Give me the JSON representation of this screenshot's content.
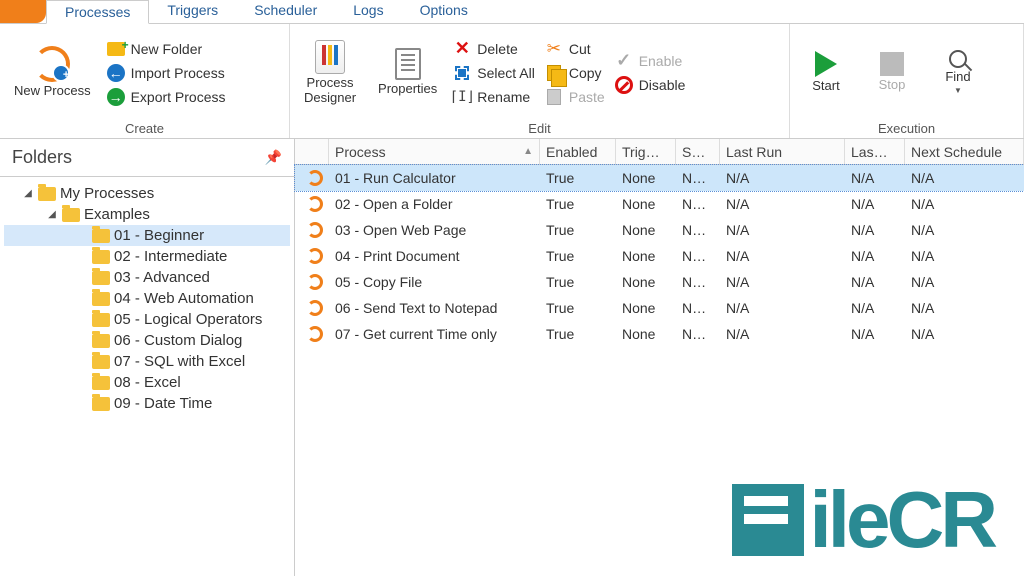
{
  "tabs": [
    "Processes",
    "Triggers",
    "Scheduler",
    "Logs",
    "Options"
  ],
  "ribbon": {
    "newProcess": "New Process",
    "newFolder": "New Folder",
    "importProcess": "Import Process",
    "exportProcess": "Export Process",
    "processDesigner": "Process\nDesigner",
    "properties": "Properties",
    "delete": "Delete",
    "selectAll": "Select All",
    "rename": "Rename",
    "cut": "Cut",
    "copy": "Copy",
    "paste": "Paste",
    "enable": "Enable",
    "disable": "Disable",
    "start": "Start",
    "stop": "Stop",
    "find": "Find",
    "groups": {
      "create": "Create",
      "edit": "Edit",
      "execution": "Execution"
    }
  },
  "foldersTitle": "Folders",
  "tree": {
    "root": "My Processes",
    "examples": "Examples",
    "items": [
      "01 - Beginner",
      "02 - Intermediate",
      "03 - Advanced",
      "04 - Web Automation",
      "05 - Logical Operators",
      "06 - Custom Dialog",
      "07 - SQL with Excel",
      "08 - Excel",
      "09 - Date Time"
    ],
    "selectedIndex": 0
  },
  "grid": {
    "headers": {
      "process": "Process",
      "enabled": "Enabled",
      "trigger": "Trig…",
      "s": "S…",
      "lastRun": "Last Run",
      "lasd": "Las…",
      "next": "Next Schedule"
    },
    "rows": [
      {
        "process": "01 - Run Calculator",
        "enabled": "True",
        "trigger": "None",
        "s": "N…",
        "lastRun": "N/A",
        "lasd": "N/A",
        "next": "N/A"
      },
      {
        "process": "02 - Open a Folder",
        "enabled": "True",
        "trigger": "None",
        "s": "N…",
        "lastRun": "N/A",
        "lasd": "N/A",
        "next": "N/A"
      },
      {
        "process": "03 - Open Web Page",
        "enabled": "True",
        "trigger": "None",
        "s": "N…",
        "lastRun": "N/A",
        "lasd": "N/A",
        "next": "N/A"
      },
      {
        "process": "04 - Print Document",
        "enabled": "True",
        "trigger": "None",
        "s": "N…",
        "lastRun": "N/A",
        "lasd": "N/A",
        "next": "N/A"
      },
      {
        "process": "05 - Copy File",
        "enabled": "True",
        "trigger": "None",
        "s": "N…",
        "lastRun": "N/A",
        "lasd": "N/A",
        "next": "N/A"
      },
      {
        "process": "06 - Send Text to Notepad",
        "enabled": "True",
        "trigger": "None",
        "s": "N…",
        "lastRun": "N/A",
        "lasd": "N/A",
        "next": "N/A"
      },
      {
        "process": "07 - Get current Time only",
        "enabled": "True",
        "trigger": "None",
        "s": "N…",
        "lastRun": "N/A",
        "lasd": "N/A",
        "next": "N/A"
      }
    ],
    "selectedIndex": 0
  },
  "watermark": "ileCR"
}
